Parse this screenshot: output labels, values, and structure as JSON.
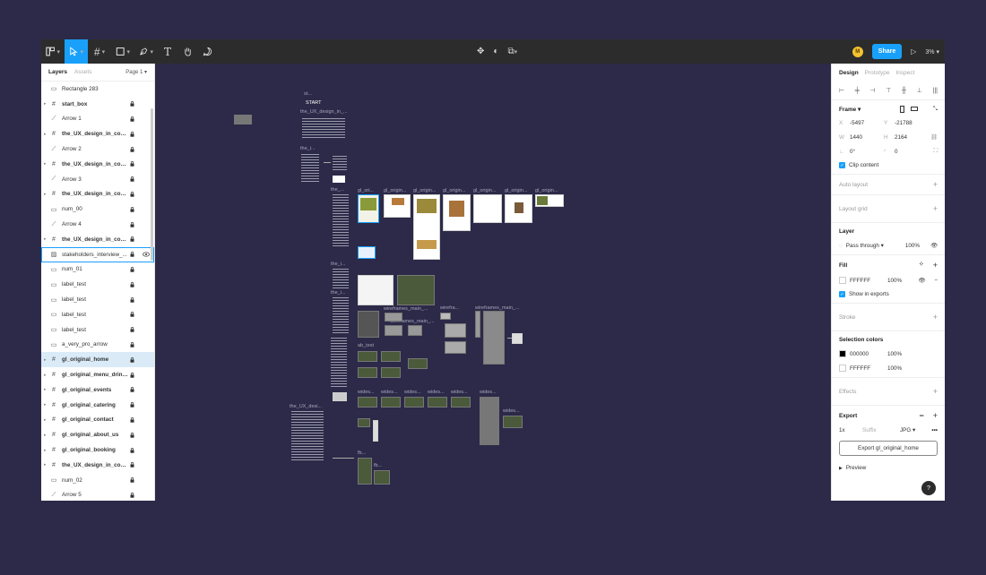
{
  "toolbar": {
    "zoom": "3%",
    "share": "Share",
    "avatar_initial": "M"
  },
  "layers_panel": {
    "tabs": [
      "Layers",
      "Assets"
    ],
    "page": "Page 1",
    "items": [
      {
        "label": "Rectangle 283",
        "icon": "rectangle-icon",
        "bold": false
      },
      {
        "label": "start_box",
        "icon": "frame-icon",
        "bold": true
      },
      {
        "label": "Arrow 1",
        "icon": "arrow-icon",
        "bold": false
      },
      {
        "label": "the_UX_design_in_conte...",
        "icon": "frame-icon",
        "bold": true
      },
      {
        "label": "Arrow 2",
        "icon": "arrow-icon",
        "bold": false
      },
      {
        "label": "the_UX_design_in_conte...",
        "icon": "frame-icon",
        "bold": true
      },
      {
        "label": "Arrow 3",
        "icon": "arrow-icon",
        "bold": false
      },
      {
        "label": "the_UX_design_in_conte...",
        "icon": "frame-icon",
        "bold": true
      },
      {
        "label": "num_00",
        "icon": "rectangle-icon",
        "bold": false
      },
      {
        "label": "Arrow 4",
        "icon": "arrow-icon",
        "bold": false
      },
      {
        "label": "the_UX_design_in_conte...",
        "icon": "frame-icon",
        "bold": true
      },
      {
        "label": "stakeholders_interview_...",
        "icon": "image-icon",
        "bold": false
      },
      {
        "label": "num_01",
        "icon": "rectangle-icon",
        "bold": false
      },
      {
        "label": "label_test",
        "icon": "rectangle-icon",
        "bold": false
      },
      {
        "label": "label_test",
        "icon": "rectangle-icon",
        "bold": false
      },
      {
        "label": "label_test",
        "icon": "rectangle-icon",
        "bold": false
      },
      {
        "label": "label_test",
        "icon": "rectangle-icon",
        "bold": false
      },
      {
        "label": "a_very_pro_arrow",
        "icon": "rectangle-icon",
        "bold": false
      },
      {
        "label": "gl_original_home",
        "icon": "frame-icon",
        "bold": true
      },
      {
        "label": "gl_original_menu_drinks",
        "icon": "frame-icon",
        "bold": true
      },
      {
        "label": "gl_original_events",
        "icon": "frame-icon",
        "bold": true
      },
      {
        "label": "gl_original_catering",
        "icon": "frame-icon",
        "bold": true
      },
      {
        "label": "gl_original_contact",
        "icon": "frame-icon",
        "bold": true
      },
      {
        "label": "gl_original_about_us",
        "icon": "frame-icon",
        "bold": true
      },
      {
        "label": "gl_original_booking",
        "icon": "frame-icon",
        "bold": true
      },
      {
        "label": "the_UX_design_in_conte...",
        "icon": "frame-icon",
        "bold": true
      },
      {
        "label": "num_02",
        "icon": "rectangle-icon",
        "bold": false
      },
      {
        "label": "Arrow 5",
        "icon": "arrow-icon",
        "bold": false
      }
    ]
  },
  "canvas": {
    "labels": {
      "st": "st...",
      "start": "START",
      "ux1": "the_UX_design_in_...",
      "the1": "the_i...",
      "the2": "the_...",
      "the3": "the_i...",
      "the4": "the_i...",
      "the5": "the_i...",
      "gl1": "gl_ori...",
      "gl2": "gl_origin...",
      "gl3": "gl_origin...",
      "gl4": "gl_origin...",
      "gl5": "gl_origin...",
      "gl6": "gl_origin...",
      "gl7": "gl_origin...",
      "wire1": "wirefra...",
      "wire2": "wireframes_main_...",
      "wire3": "wireframes_main_...",
      "ab": "ab_test",
      "w1": "wides...",
      "w2": "wides...",
      "w3": "wides...",
      "w4": "wides...",
      "w5": "wides...",
      "w6": "wides...",
      "w7": "wides...",
      "uxdes": "the_UX_desi...",
      "fb1": "fb...",
      "fb2": "fb..."
    }
  },
  "properties_panel": {
    "tabs": [
      "Design",
      "Prototype",
      "Inspect"
    ],
    "frame": {
      "label": "Frame",
      "x": "-5497",
      "y": "-21788",
      "w": "1440",
      "h": "2164",
      "rotation": "0°",
      "radius": "0",
      "clip_content": "Clip content"
    },
    "auto_layout": "Auto layout",
    "layout_grid": "Layout grid",
    "layer": {
      "title": "Layer",
      "blend": "Pass through",
      "opacity": "100%"
    },
    "fill": {
      "title": "Fill",
      "hex": "FFFFFF",
      "opacity": "100%",
      "show_in_exports": "Show in exports"
    },
    "stroke": "Stroke",
    "selection_colors": {
      "title": "Selection colors",
      "colors": [
        {
          "hex": "000000",
          "opacity": "100%",
          "swatch": "#000000"
        },
        {
          "hex": "FFFFFF",
          "opacity": "100%",
          "swatch": "#ffffff"
        }
      ]
    },
    "effects": "Effects",
    "export": {
      "title": "Export",
      "scale": "1x",
      "suffix": "Suffix",
      "format": "JPG",
      "button": "Export gl_original_home",
      "preview": "Preview"
    },
    "help": "?"
  }
}
